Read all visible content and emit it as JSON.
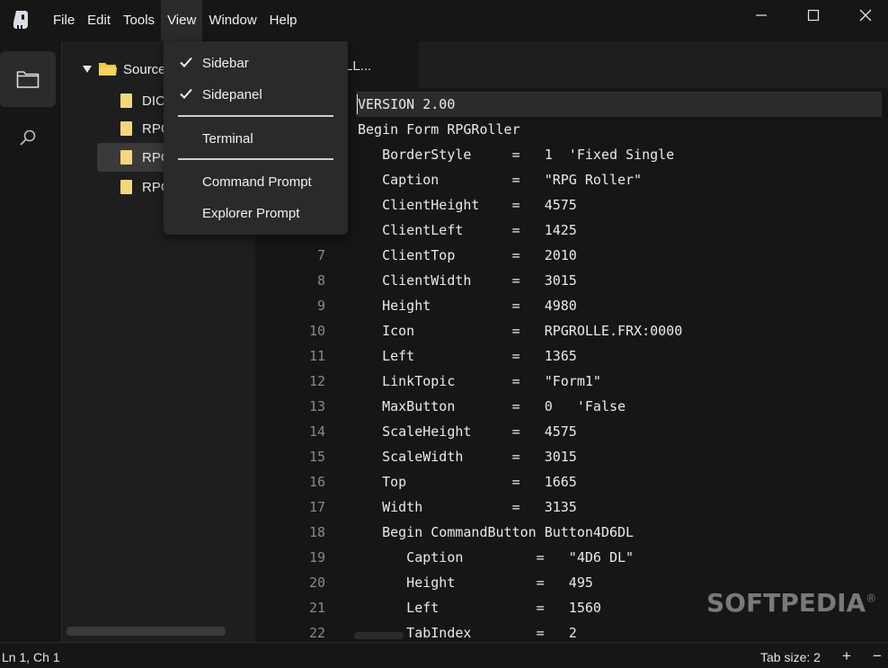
{
  "menubar": {
    "file": "File",
    "edit": "Edit",
    "tools": "Tools",
    "view": "View",
    "window": "Window",
    "help": "Help"
  },
  "sidebar": {
    "root_label": "Source",
    "items": [
      {
        "label": "DICI"
      },
      {
        "label": "RPG"
      },
      {
        "label": "RPG"
      },
      {
        "label": "RPG"
      }
    ]
  },
  "tab": {
    "label": "LL..."
  },
  "view_menu": {
    "sidebar": "Sidebar",
    "sidepanel": "Sidepanel",
    "terminal": "Terminal",
    "command_prompt": "Command Prompt",
    "explorer_prompt": "Explorer Prompt"
  },
  "code": {
    "lines": [
      {
        "n": "",
        "text": "VERSION 2.00"
      },
      {
        "n": "",
        "text": "Begin Form RPGRoller"
      },
      {
        "n": "",
        "text": "   BorderStyle     =   1  'Fixed Single"
      },
      {
        "n": "",
        "text": "   Caption         =   \"RPG Roller\""
      },
      {
        "n": "",
        "text": "   ClientHeight    =   4575"
      },
      {
        "n": "",
        "text": "   ClientLeft      =   1425"
      },
      {
        "n": "7",
        "text": "   ClientTop       =   2010"
      },
      {
        "n": "8",
        "text": "   ClientWidth     =   3015"
      },
      {
        "n": "9",
        "text": "   Height          =   4980"
      },
      {
        "n": "10",
        "text": "   Icon            =   RPGROLLE.FRX:0000"
      },
      {
        "n": "11",
        "text": "   Left            =   1365"
      },
      {
        "n": "12",
        "text": "   LinkTopic       =   \"Form1\""
      },
      {
        "n": "13",
        "text": "   MaxButton       =   0   'False"
      },
      {
        "n": "14",
        "text": "   ScaleHeight     =   4575"
      },
      {
        "n": "15",
        "text": "   ScaleWidth      =   3015"
      },
      {
        "n": "16",
        "text": "   Top             =   1665"
      },
      {
        "n": "17",
        "text": "   Width           =   3135"
      },
      {
        "n": "18",
        "text": "   Begin CommandButton Button4D6DL"
      },
      {
        "n": "19",
        "text": "      Caption         =   \"4D6 DL\""
      },
      {
        "n": "20",
        "text": "      Height          =   495"
      },
      {
        "n": "21",
        "text": "      Left            =   1560"
      },
      {
        "n": "22",
        "text": "      TabIndex        =   2"
      }
    ]
  },
  "statusbar": {
    "position": "Ln 1, Ch 1",
    "tab_size": "Tab size: 2",
    "plus": "+",
    "minus": "−"
  },
  "watermark": {
    "text": "SOFTPEDIA",
    "mark": "®"
  },
  "colors": {
    "folder": "#f5c542",
    "file": "#f5d77a",
    "background": "#161616",
    "sidebar_bg": "#1e1e1e",
    "menu_bg": "#2a2a2a"
  }
}
